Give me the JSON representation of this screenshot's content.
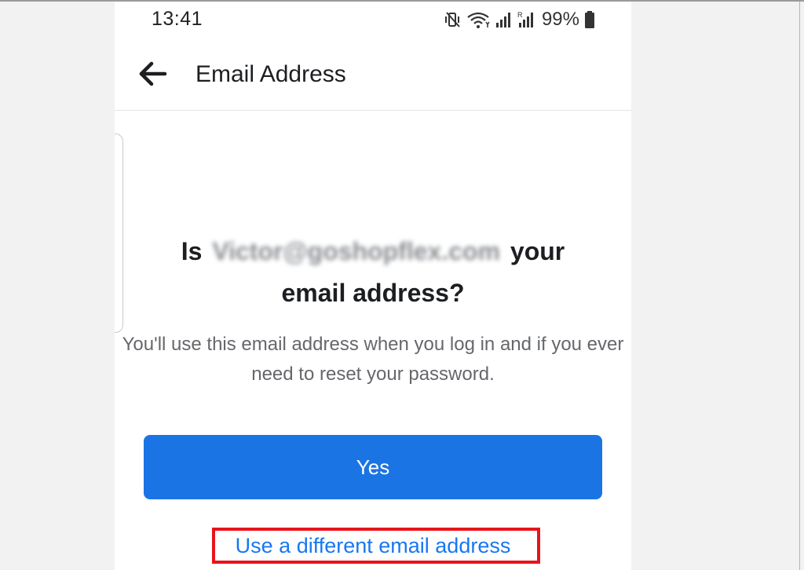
{
  "status_bar": {
    "time": "13:41",
    "battery_pct": "99%",
    "icons": [
      "vibrate-mute-icon",
      "wifi-icon",
      "signal-icon",
      "signal-roaming-icon",
      "battery-icon"
    ]
  },
  "app_bar": {
    "title": "Email Address",
    "back_icon": "arrow-left-icon"
  },
  "prompt": {
    "question_prefix": "Is",
    "email": "Victor@goshopflex.com",
    "question_suffix": "your",
    "question_line2": "email address?",
    "subtext": "You'll use this email address when you log in and if you ever need to reset your password."
  },
  "actions": {
    "yes_label": "Yes",
    "different_email_label": "Use a different email address"
  },
  "colors": {
    "primary_button": "#1b74e4",
    "link": "#1877f2",
    "highlight": "#e8141b"
  }
}
